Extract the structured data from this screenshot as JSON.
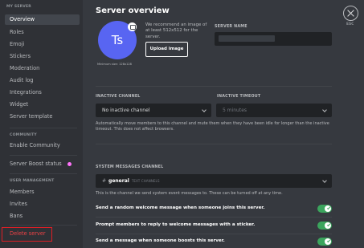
{
  "sidebar": {
    "header": "My Server",
    "items": [
      {
        "label": "Overview"
      },
      {
        "label": "Roles"
      },
      {
        "label": "Emoji"
      },
      {
        "label": "Stickers"
      },
      {
        "label": "Moderation"
      },
      {
        "label": "Audit log"
      },
      {
        "label": "Integrations"
      },
      {
        "label": "Widget"
      },
      {
        "label": "Server template"
      }
    ],
    "community_section": "COMMUNITY",
    "enable_community": "Enable Community",
    "boost_status": "Server Boost status",
    "user_management_section": "USER MANAGEMENT",
    "members": "Members",
    "invites": "Invites",
    "bans": "Bans",
    "delete_server": "Delete server"
  },
  "main": {
    "title": "Server overview",
    "avatar_initials": "Ts",
    "min_size": "Minimum size: 128x128",
    "recommend_text": "We recommend an image of at least 512x512 for the server.",
    "upload_label": "Upload image",
    "server_name_label": "SERVER NAME",
    "inactive_channel_label": "INACTIVE CHANNEL",
    "inactive_channel_value": "No inactive channel",
    "inactive_timeout_label": "INACTIVE TIMEOUT",
    "inactive_timeout_value": "5 minutes",
    "inactive_note": "Automatically move members to this channel and mute them when they have been idle for longer than the inactive timeout. This does not affect browsers.",
    "system_channel_label": "SYSTEM MESSAGES CHANNEL",
    "system_channel_hash": "#",
    "system_channel_name": "general",
    "system_channel_category": "TEXT CHANNELS",
    "system_note": "This is the channel we send system event messages to. These can be turned off at any time.",
    "options": [
      {
        "label": "Send a random welcome message when someone joins this server.",
        "enabled": true
      },
      {
        "label": "Prompt members to reply to welcome messages with a sticker.",
        "enabled": true
      },
      {
        "label": "Send a message when someone boosts this server.",
        "enabled": true
      }
    ]
  },
  "close": {
    "esc_label": "ESC"
  },
  "colors": {
    "accent": "#5865f2",
    "toggle_on": "#3ba55d",
    "danger": "#ed4245",
    "boost": "#ff73fa"
  }
}
